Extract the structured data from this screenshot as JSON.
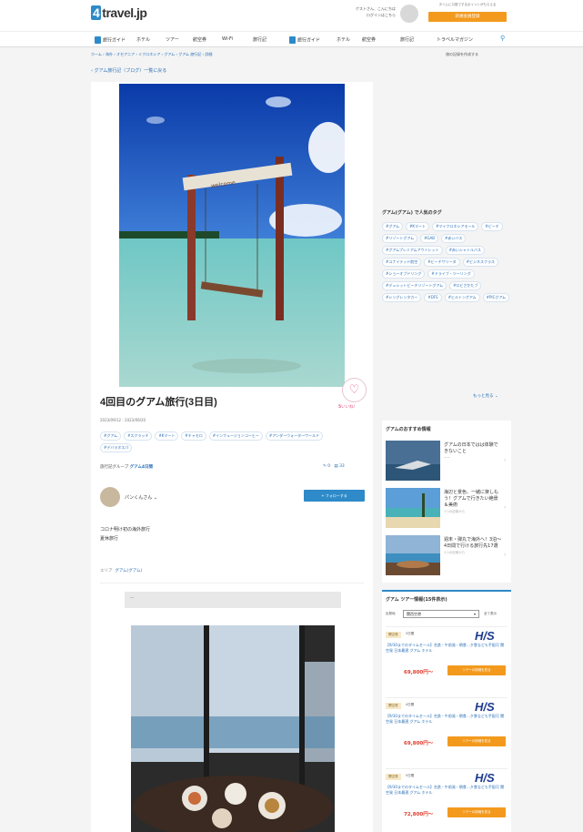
{
  "header": {
    "logo_prefix": "4",
    "logo_text": "travel.jp",
    "greeting": "ゲストさん、こんにちは",
    "login": "ログインはこちら",
    "promo": "タイムに口座でするポイントがもらえる",
    "signup": "新規会員登録"
  },
  "nav": [
    "旅行ガイド",
    "ホテル",
    "ツアー",
    "航空券",
    "Wi-Fi",
    "旅行記",
    "旅行ガイド",
    "ホテル",
    "航空券",
    "旅行記",
    "トラベルマガジン"
  ],
  "breadcrumb": "ホーム › 海外 › オセアニア › ミクロネシア › グアム › グアム 旅行記 › 詳細",
  "make_trip": "旅の記録を作成する",
  "back_link": "グアム旅行記（ブログ）一覧に戻る",
  "article": {
    "title": "4回目のグアム旅行(3日目)",
    "dates": "2023/09/12 - 2023/09/20",
    "tags": [
      "#グアム",
      "#スクラッチ",
      "#Kマート",
      "#チャモロ",
      "#インフュージョンコーヒー",
      "#アンダーウォーターワールド",
      "#デバラネスパ"
    ],
    "trip_info_label": "旅行記グループ",
    "trip_info_link": "グアム4日間",
    "like_label": "いいね!",
    "like_count": "5",
    "comment_count": "0",
    "photo_count": "33",
    "author": "パンくんさん",
    "follow": "+ フォローする",
    "body_lines": [
      "コロナ明け初の海外旅行",
      "夏休旅行"
    ],
    "area_label": "エリア",
    "area_link": "グアム(グアム)",
    "caption": "---"
  },
  "sidebar": {
    "tags_heading": "グアム(グアム) で人気のタグ",
    "tags": [
      "#グアム",
      "#Kマート",
      "#マイクロネシアモール",
      "#ビーチ",
      "#リゾートグアム",
      "#GAB",
      "#赤いバス",
      "#グアムプレミアムアウトレット",
      "#赤いシャトルバス",
      "#ユナイテッド航空",
      "#ビーチサリーヌ",
      "#ビジネスクラス",
      "#ショーオブドリング",
      "#ドライブ・ツーリング",
      "#デュシットビーチリゾートグアム",
      "#ロビさかたブ",
      "#シングレンタカー",
      "#DFS",
      "#ヒルトングアム",
      "#PICグアム"
    ],
    "more": "もっと見る",
    "rec_heading": "グアムのおすすめ情報",
    "rec_items": [
      {
        "title": "グアムの日本ではは体験できないこと",
        "sub": "ーー"
      },
      {
        "title": "海辺と景色、一緒に楽しもう！グアムで行きたい絶景＆美術",
        "sub": "1つの記事から"
      },
      {
        "title": "週末・弾丸で海外へ！3泊〜4日間で行ける旅行先17選",
        "sub": "1つの記事から"
      }
    ],
    "tour_heading": "グアム ツアー情報(15件表示)",
    "tour_select_label": "出発地",
    "tour_select": "関西空港",
    "tour_select_right": "全て表示",
    "tours": [
      {
        "badge": "関空発",
        "days": "3日間",
        "desc": "【9/30までのタイムセール】名鉄・午前発・朝食…夕食なども手配可 関空発 日本最適 グアム ホテル",
        "price": "69,800円〜",
        "btn": "ツアーの詳細を見る"
      },
      {
        "badge": "関空発",
        "days": "4日間",
        "desc": "【9/30までのタイムセール】名鉄・午前発・朝食…夕食なども手配可 関空発 日本最適 グアム ホテル",
        "price": "69,800円〜",
        "btn": "ツアーの詳細を見る"
      },
      {
        "badge": "関空発",
        "days": "5日間",
        "desc": "【9/30までのタイムセール】名鉄・午前発・朝食…夕食なども手配可 関空発 日本最適 グアム ホテル",
        "price": "72,800円〜",
        "btn": "ツアーの詳細を見る"
      }
    ],
    "his": "H/S"
  }
}
